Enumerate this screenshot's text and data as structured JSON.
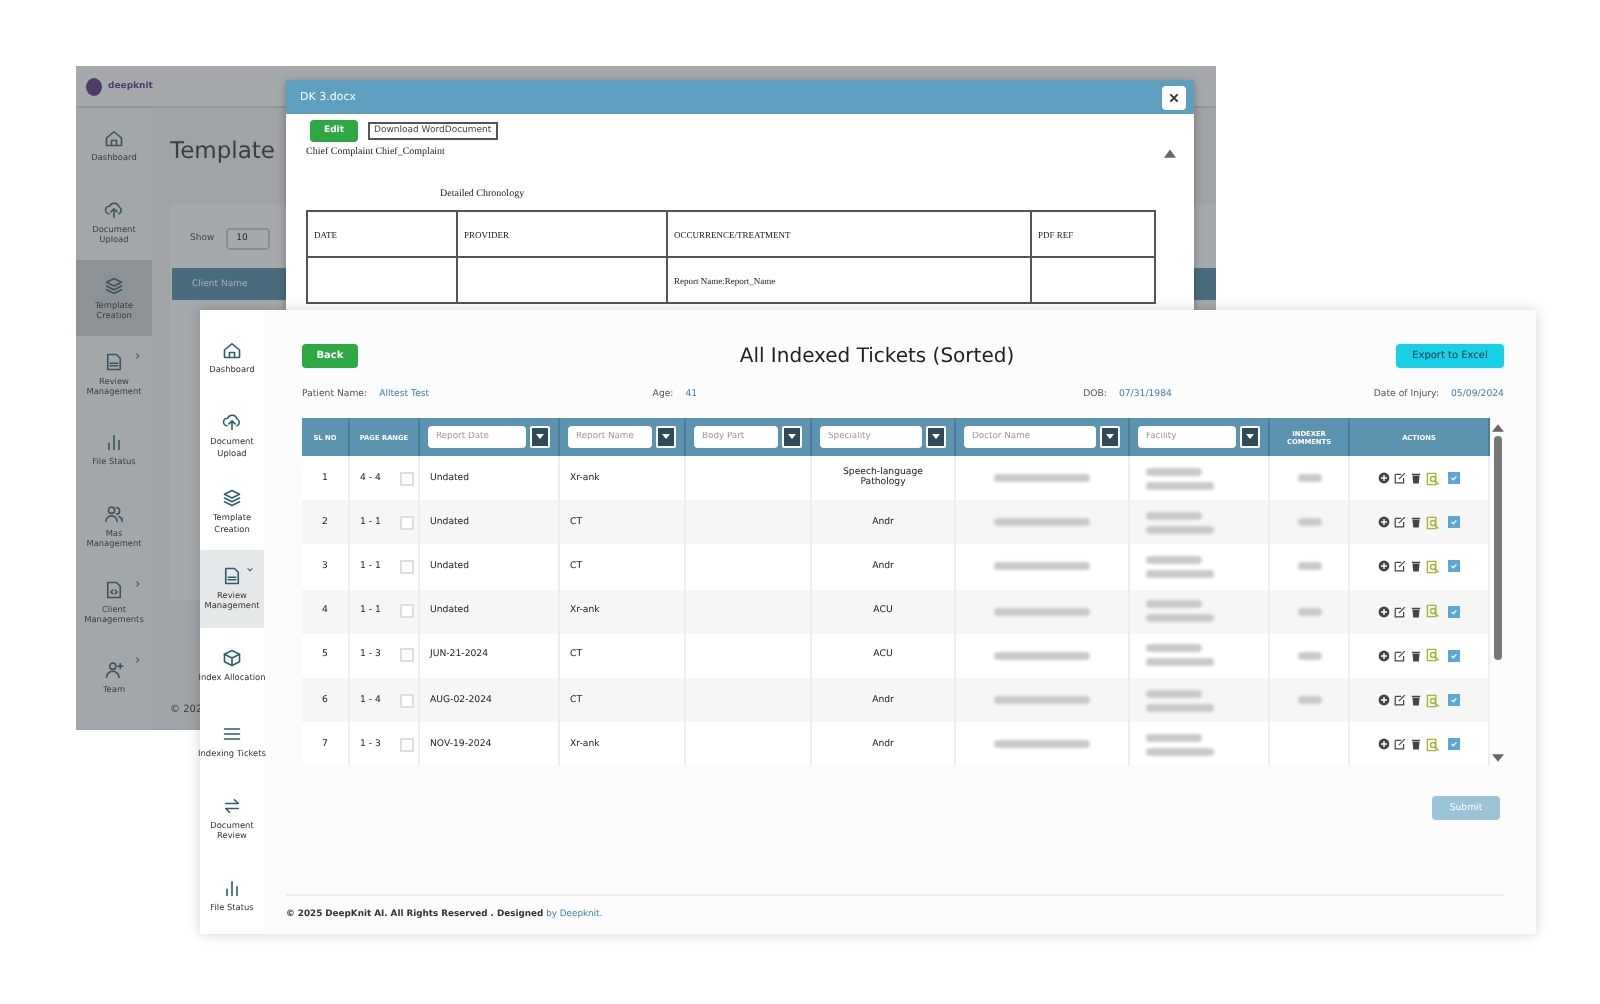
{
  "background_app": {
    "logo": "deepknit",
    "title": "Template",
    "show_label": "Show",
    "page_size": "10",
    "table_column_1": "Client Name",
    "footer": "© 202",
    "sidebar": {
      "items": [
        {
          "label": "Dashboard",
          "selected": false
        },
        {
          "label": "Document Upload",
          "selected": false
        },
        {
          "label": "Template Creation",
          "selected": true
        },
        {
          "label": "Review Management",
          "selected": false,
          "expanded": false
        },
        {
          "label": "File Status",
          "selected": false
        },
        {
          "label": "Mas Management",
          "selected": false
        },
        {
          "label": "Client Managements",
          "selected": false,
          "expanded": false
        },
        {
          "label": "Team",
          "selected": false,
          "expanded": false
        }
      ]
    }
  },
  "dialog": {
    "title": "DK 3.docx",
    "edit_button": "Edit",
    "download_button": "Download WordDocument",
    "text": "Chief Complaint Chief_Complaint",
    "heading": "Detailed Chronology",
    "table": {
      "columns": [
        "DATE",
        "PROVIDER",
        "OCCURRENCE/TREATMENT",
        "PDF REF"
      ],
      "rows": [
        {
          "cells": [
            null,
            null,
            "Report Name:Report_Name",
            null
          ]
        }
      ]
    }
  },
  "app": {
    "sidebar": {
      "items": [
        {
          "label": "Dashboard",
          "selected": false
        },
        {
          "label": "Document Upload",
          "selected": false
        },
        {
          "label": "Template Creation",
          "selected": false
        },
        {
          "label": "Review Management",
          "selected": true,
          "expanded": true
        },
        {
          "label": "Index Allocation",
          "selected": false
        },
        {
          "label": "Indexing Tickets",
          "selected": false
        },
        {
          "label": "Document Review",
          "selected": false
        },
        {
          "label": "File Status",
          "selected": false
        }
      ]
    },
    "back_button": "Back",
    "title": "All Indexed Tickets (Sorted)",
    "export_button": "Export to Excel",
    "patient": [
      {
        "label": "Patient Name:",
        "value": "Alltest Test"
      },
      {
        "label": "Age:",
        "value": "41"
      },
      {
        "label": "DOB:",
        "value": "07/31/1984"
      },
      {
        "label": "Date of Injury:",
        "value": "05/09/2024"
      }
    ],
    "table": {
      "columns": [
        {
          "kind": "text",
          "label": "SL NO"
        },
        {
          "kind": "text",
          "label": "PAGE RANGE"
        },
        {
          "kind": "filter",
          "placeholder": "Report Date"
        },
        {
          "kind": "filter",
          "placeholder": "Report Name"
        },
        {
          "kind": "filter",
          "placeholder": "Body Part"
        },
        {
          "kind": "filter",
          "placeholder": "Speciality"
        },
        {
          "kind": "filter",
          "placeholder": "Doctor Name"
        },
        {
          "kind": "filter",
          "placeholder": "Facility"
        },
        {
          "kind": "text",
          "label": "INDEXER COMMENTS"
        },
        {
          "kind": "text",
          "label": "ACTIONS"
        }
      ],
      "rows": [
        {
          "sl": "1",
          "pages": "4 - 4",
          "checked": false,
          "report_date": "Undated",
          "report_name": "Xr-ank",
          "speciality": "Speech-language Pathology",
          "has_comment": true,
          "verified": true
        },
        {
          "sl": "2",
          "pages": "1 - 1",
          "checked": false,
          "report_date": "Undated",
          "report_name": "CT",
          "speciality": "Andr",
          "has_comment": true,
          "verified": true
        },
        {
          "sl": "3",
          "pages": "1 - 1",
          "checked": false,
          "report_date": "Undated",
          "report_name": "CT",
          "speciality": "Andr",
          "has_comment": true,
          "verified": true
        },
        {
          "sl": "4",
          "pages": "1 - 1",
          "checked": false,
          "report_date": "Undated",
          "report_name": "Xr-ank",
          "speciality": "ACU",
          "has_comment": true,
          "verified": true
        },
        {
          "sl": "5",
          "pages": "1 - 3",
          "checked": false,
          "report_date": "JUN-21-2024",
          "report_name": "CT",
          "speciality": "ACU",
          "has_comment": true,
          "verified": true
        },
        {
          "sl": "6",
          "pages": "1 - 4",
          "checked": false,
          "report_date": "AUG-02-2024",
          "report_name": "CT",
          "speciality": "Andr",
          "has_comment": true,
          "verified": true
        },
        {
          "sl": "7",
          "pages": "1 - 3",
          "checked": false,
          "report_date": "NOV-19-2024",
          "report_name": "Xr-ank",
          "speciality": "Andr",
          "has_comment": false,
          "verified": true
        }
      ]
    },
    "submit_button": "Submit",
    "footer": "© 2025 DeepKnit AI. All Rights Reserved . Designed ",
    "footer_link": "by Deepknit."
  }
}
